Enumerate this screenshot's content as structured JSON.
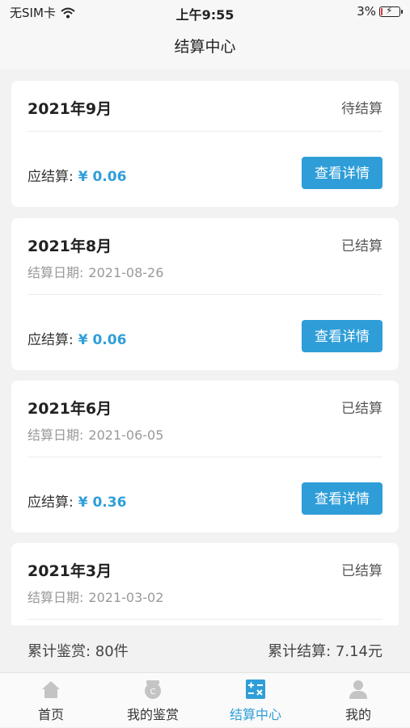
{
  "status_bar": {
    "carrier": "无SIM卡",
    "time": "上午9:55",
    "battery": "3%"
  },
  "nav": {
    "title": "结算中心"
  },
  "cards": [
    {
      "month": "2021年9月",
      "state": "待结算",
      "date_label": "",
      "date": "",
      "amount_label": "应结算:",
      "amount": "¥ 0.06",
      "button": "查看详情"
    },
    {
      "month": "2021年8月",
      "state": "已结算",
      "date_label": "结算日期:",
      "date": "2021-08-26",
      "amount_label": "应结算:",
      "amount": "¥ 0.06",
      "button": "查看详情"
    },
    {
      "month": "2021年6月",
      "state": "已结算",
      "date_label": "结算日期:",
      "date": "2021-06-05",
      "amount_label": "应结算:",
      "amount": "¥ 0.36",
      "button": "查看详情"
    },
    {
      "month": "2021年3月",
      "state": "已结算",
      "date_label": "结算日期:",
      "date": "2021-03-02"
    }
  ],
  "summary": {
    "left": "累计鉴赏: 80件",
    "right": "累计结算: 7.14元"
  },
  "tabs": [
    {
      "label": "首页",
      "icon": "home-icon"
    },
    {
      "label": "我的鉴赏",
      "icon": "appraisal-icon"
    },
    {
      "label": "结算中心",
      "icon": "calculator-icon"
    },
    {
      "label": "我的",
      "icon": "user-icon"
    }
  ],
  "colors": {
    "accent": "#2f9ed8",
    "battery_low": "#e03b3b"
  }
}
